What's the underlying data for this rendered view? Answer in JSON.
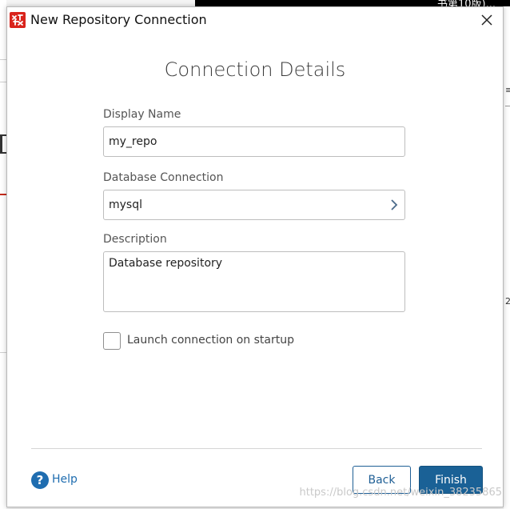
{
  "background": {
    "topbar_text": "书第10版)...",
    "right_mark1": "≡",
    "right_mark2": "2"
  },
  "dialog": {
    "title": "New Repository Connection",
    "app_icon": "app-logo-icon",
    "close_icon": "close-icon"
  },
  "form": {
    "heading": "Connection Details",
    "display_name": {
      "label": "Display Name",
      "value": "my_repo"
    },
    "database_connection": {
      "label": "Database Connection",
      "value": "mysql"
    },
    "description": {
      "label": "Description",
      "value": "Database repository"
    },
    "launch_on_startup": {
      "label": "Launch connection on startup",
      "checked": false
    }
  },
  "footer": {
    "help_label": "Help",
    "back_label": "Back",
    "finish_label": "Finish"
  },
  "watermark": "https://blog.csdn.net/weixin_38235865",
  "colors": {
    "accent": "#1a6196",
    "help": "#1f6db0",
    "brand": "#d9241c"
  }
}
